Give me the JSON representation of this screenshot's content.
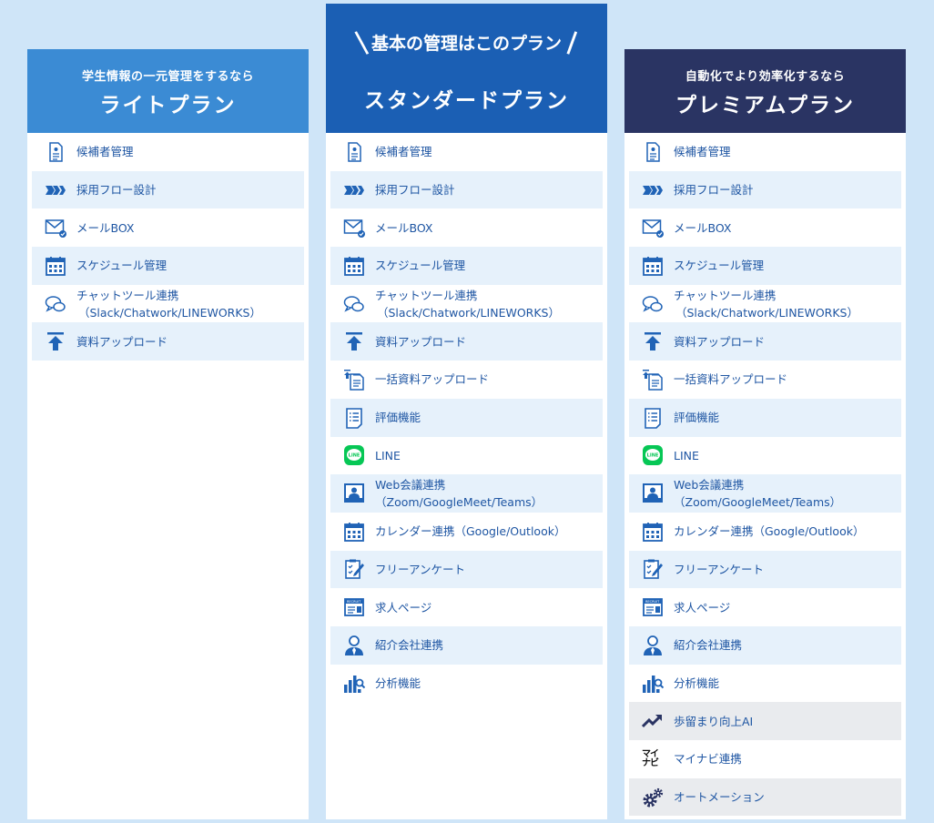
{
  "colors": {
    "background": "#cfe5f8",
    "light_header": "#3b8bd4",
    "standard_header": "#1b5fb4",
    "premium_header": "#2a3463",
    "item_text": "#1f56a3",
    "row_alt": "#e6f1fb",
    "row_gray": "#e9ebee"
  },
  "plans": [
    {
      "subtitle": "学生情報の一元管理をするなら",
      "name": "ライトプラン",
      "items": [
        {
          "icon": "document-icon",
          "label": "候補者管理"
        },
        {
          "icon": "flow-arrows-icon",
          "label": "採用フロー設計"
        },
        {
          "icon": "mail-icon",
          "label": "メールBOX"
        },
        {
          "icon": "calendar-icon",
          "label": "スケジュール管理"
        },
        {
          "icon": "chat-icon",
          "label": "チャットツール連携",
          "label2": "（Slack/Chatwork/LINEWORKS）"
        },
        {
          "icon": "upload-icon",
          "label": "資料アップロード"
        }
      ]
    },
    {
      "badge": "基本の管理はこのプラン",
      "name": "スタンダードプラン",
      "items": [
        {
          "icon": "document-icon",
          "label": "候補者管理"
        },
        {
          "icon": "flow-arrows-icon",
          "label": "採用フロー設計"
        },
        {
          "icon": "mail-icon",
          "label": "メールBOX"
        },
        {
          "icon": "calendar-icon",
          "label": "スケジュール管理"
        },
        {
          "icon": "chat-icon",
          "label": "チャットツール連携",
          "label2": "（Slack/Chatwork/LINEWORKS）"
        },
        {
          "icon": "upload-icon",
          "label": "資料アップロード"
        },
        {
          "icon": "bulk-upload-icon",
          "label": "一括資料アップロード"
        },
        {
          "icon": "evaluation-icon",
          "label": "評価機能"
        },
        {
          "icon": "line-icon",
          "label": "LINE"
        },
        {
          "icon": "web-meeting-icon",
          "label": "Web会議連携（Zoom/GoogleMeet/Teams）"
        },
        {
          "icon": "calendar-link-icon",
          "label": "カレンダー連携（Google/Outlook）"
        },
        {
          "icon": "survey-icon",
          "label": "フリーアンケート"
        },
        {
          "icon": "job-page-icon",
          "label": "求人ページ"
        },
        {
          "icon": "agency-icon",
          "label": "紹介会社連携"
        },
        {
          "icon": "analytics-icon",
          "label": "分析機能"
        }
      ]
    },
    {
      "subtitle": "自動化でより効率化するなら",
      "name": "プレミアムプラン",
      "items": [
        {
          "icon": "document-icon",
          "label": "候補者管理"
        },
        {
          "icon": "flow-arrows-icon",
          "label": "採用フロー設計"
        },
        {
          "icon": "mail-icon",
          "label": "メールBOX"
        },
        {
          "icon": "calendar-icon",
          "label": "スケジュール管理"
        },
        {
          "icon": "chat-icon",
          "label": "チャットツール連携",
          "label2": "（Slack/Chatwork/LINEWORKS）"
        },
        {
          "icon": "upload-icon",
          "label": "資料アップロード"
        },
        {
          "icon": "bulk-upload-icon",
          "label": "一括資料アップロード"
        },
        {
          "icon": "evaluation-icon",
          "label": "評価機能"
        },
        {
          "icon": "line-icon",
          "label": "LINE"
        },
        {
          "icon": "web-meeting-icon",
          "label": "Web会議連携（Zoom/GoogleMeet/Teams）"
        },
        {
          "icon": "calendar-link-icon",
          "label": "カレンダー連携（Google/Outlook）"
        },
        {
          "icon": "survey-icon",
          "label": "フリーアンケート"
        },
        {
          "icon": "job-page-icon",
          "label": "求人ページ"
        },
        {
          "icon": "agency-icon",
          "label": "紹介会社連携"
        },
        {
          "icon": "analytics-icon",
          "label": "分析機能"
        },
        {
          "icon": "trend-up-icon",
          "label": "歩留まり向上AI"
        },
        {
          "icon": "mynavi-logo-icon",
          "label": "マイナビ連携",
          "logo_text": "マイナビ"
        },
        {
          "icon": "gears-icon",
          "label": "オートメーション"
        }
      ]
    }
  ]
}
